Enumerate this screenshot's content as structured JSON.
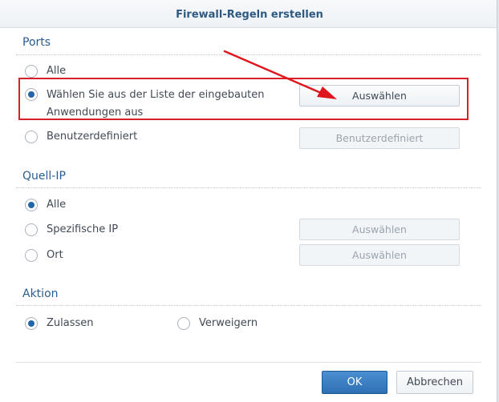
{
  "dialog": {
    "title": "Firewall-Regeln erstellen"
  },
  "ports": {
    "heading": "Ports",
    "options": [
      {
        "label": "Alle",
        "checked": false
      },
      {
        "label_line1": "Wählen Sie aus der Liste der eingebauten",
        "label_line2": "Anwendungen aus",
        "checked": true
      },
      {
        "label": "Benutzerdefiniert",
        "checked": false
      }
    ],
    "select_button": "Auswählen",
    "custom_button": "Benutzerdefiniert"
  },
  "source_ip": {
    "heading": "Quell-IP",
    "options": [
      {
        "label": "Alle",
        "checked": true
      },
      {
        "label": "Spezifische IP",
        "checked": false
      },
      {
        "label": "Ort",
        "checked": false
      }
    ],
    "ip_select_button": "Auswählen",
    "location_select_button": "Auswählen"
  },
  "action": {
    "heading": "Aktion",
    "options": [
      {
        "label": "Zulassen",
        "checked": true
      },
      {
        "label": "Verweigern",
        "checked": false
      }
    ]
  },
  "footer": {
    "ok": "OK",
    "cancel": "Abbrechen"
  },
  "colors": {
    "accent": "#2465a8",
    "annotation": "#d9202a",
    "heading": "#2a5d8f"
  },
  "icons": [
    "radio-button-icon",
    "annotation-arrow-icon"
  ]
}
